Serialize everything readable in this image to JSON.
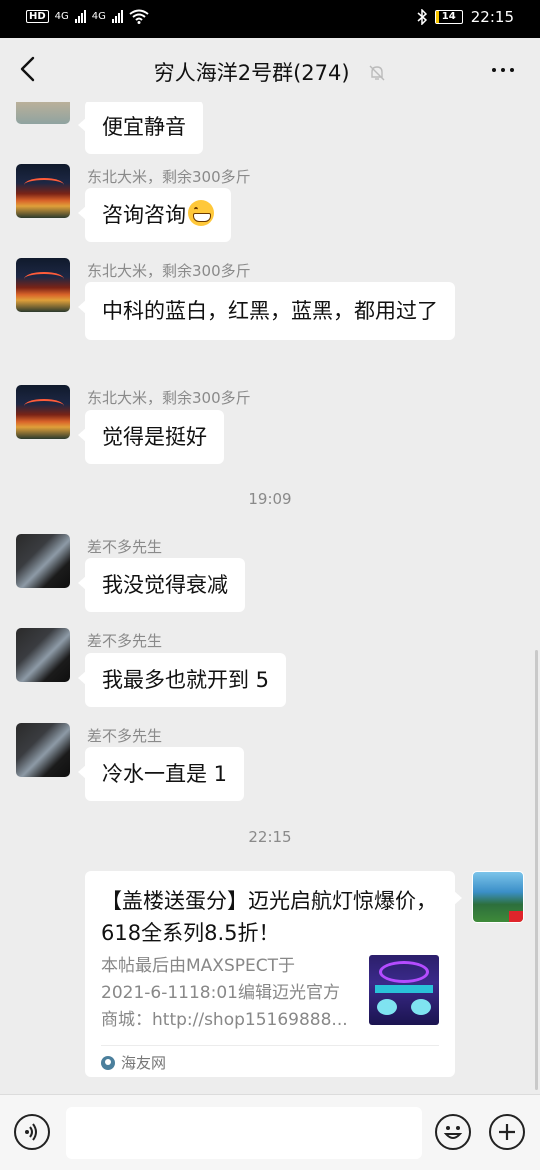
{
  "status_bar": {
    "network_left": "HD",
    "signal1": "4G",
    "signal2": "4G",
    "battery": "14",
    "time": "22:15"
  },
  "header": {
    "title": "穷人海洋2号群(274)"
  },
  "messages": [
    {
      "sender": "",
      "text": "便宜静音",
      "avatar": "beach"
    },
    {
      "sender": "东北大米，剩余300多斤",
      "text": "咨询咨询",
      "avatar": "night",
      "emoji": "grinning-face"
    },
    {
      "sender": "东北大米，剩余300多斤",
      "text": "中科的蓝白，红黑，蓝黑，都用过了",
      "avatar": "night"
    },
    {
      "sender": "东北大米，剩余300多斤",
      "text": "觉得是挺好",
      "avatar": "night"
    },
    {
      "sender": "差不多先生",
      "text": "我没觉得衰减",
      "avatar": "dark"
    },
    {
      "sender": "差不多先生",
      "text": "我最多也就开到 5",
      "avatar": "dark"
    },
    {
      "sender": "差不多先生",
      "text": "冷水一直是 1",
      "avatar": "dark"
    }
  ],
  "timestamps": [
    "19:09",
    "22:15"
  ],
  "link_card": {
    "title": "【盖楼送蛋分】迈光启航灯惊爆价，618全系列8.5折！",
    "desc_line1": "本帖最后由MAXSPECT于",
    "desc_line2": "2021-6-1118:01编辑迈光官方",
    "desc_line3": "商城：http://shop15169888...",
    "source": "海友网"
  },
  "input": {
    "placeholder": ""
  },
  "colors": {
    "background": "#ededed",
    "bubble": "#ffffff",
    "meta_text": "#8a8a8a"
  }
}
